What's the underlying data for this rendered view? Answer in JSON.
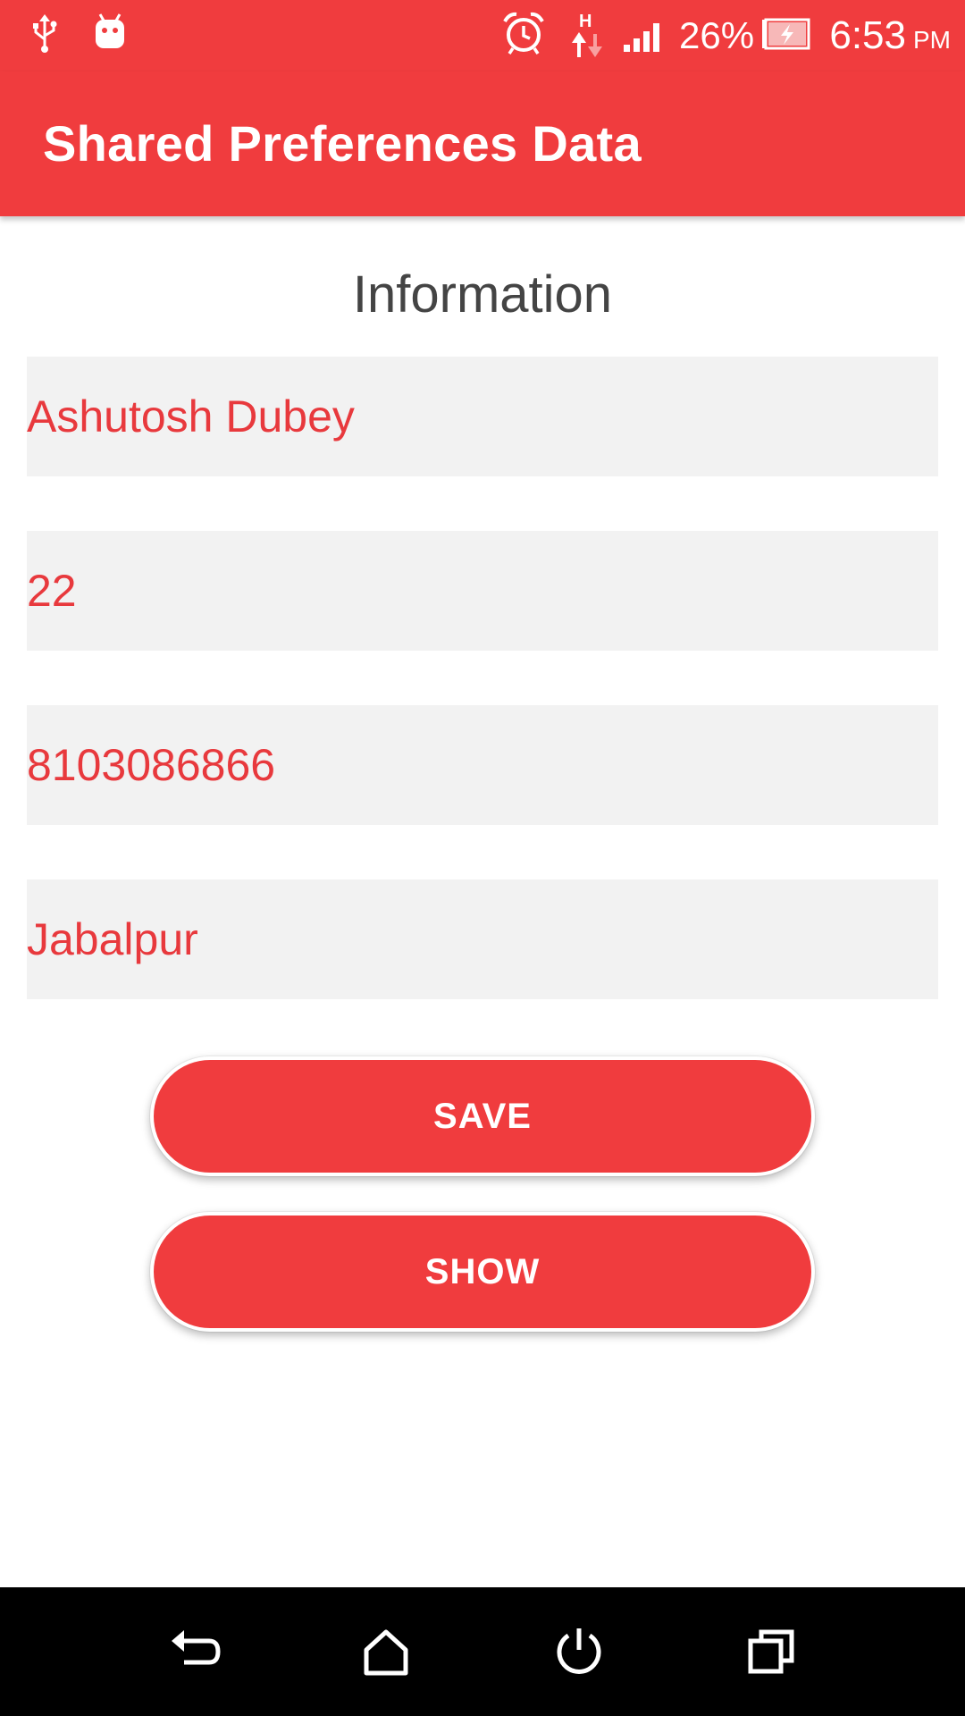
{
  "status_bar": {
    "icons": [
      "usb-icon",
      "android-debug-icon",
      "alarm-icon",
      "h-network-icon",
      "signal-icon",
      "battery-charging-icon"
    ],
    "battery_percent": "26%",
    "time": "6:53",
    "ampm": "PM"
  },
  "app_bar": {
    "title": "Shared Preferences Data"
  },
  "form": {
    "heading": "Information",
    "fields": [
      {
        "value": "Ashutosh Dubey"
      },
      {
        "value": "22"
      },
      {
        "value": "8103086866"
      },
      {
        "value": "Jabalpur"
      }
    ],
    "save_label": "SAVE",
    "show_label": "SHOW"
  },
  "nav_bar": {
    "icons": [
      "back-icon",
      "home-icon",
      "power-icon",
      "recents-icon"
    ]
  },
  "colors": {
    "accent": "#f03c3e",
    "field_text": "#e8393d",
    "field_background": "#f2f2f2",
    "heading_text": "#444444"
  }
}
